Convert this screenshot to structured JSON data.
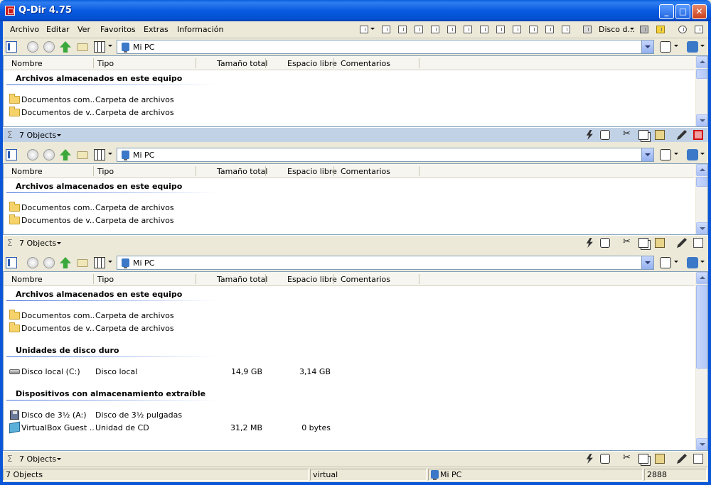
{
  "window": {
    "title": "Q-Dir 4.75"
  },
  "menu": {
    "items": [
      "Archivo",
      "Editar",
      "Ver",
      "Favoritos",
      "Extras",
      "Información"
    ],
    "disk_label": "Disco d..."
  },
  "panes": [
    {
      "address": "Mi PC",
      "columns": [
        "Nombre",
        "Tipo",
        "Tamaño total",
        "Espacio libre",
        "Comentarios"
      ],
      "groups": [
        {
          "title": "Archivos almacenados en este equipo",
          "rows": [
            {
              "name": "Documentos com...",
              "type": "Carpeta de archivos",
              "size": "",
              "free": "",
              "icon": "folder-icon"
            },
            {
              "name": "Documentos de v...",
              "type": "Carpeta de archivos",
              "size": "",
              "free": "",
              "icon": "folder-icon"
            }
          ]
        }
      ],
      "status": "7 Objects"
    },
    {
      "address": "Mi PC",
      "columns": [
        "Nombre",
        "Tipo",
        "Tamaño total",
        "Espacio libre",
        "Comentarios"
      ],
      "groups": [
        {
          "title": "Archivos almacenados en este equipo",
          "rows": [
            {
              "name": "Documentos com...",
              "type": "Carpeta de archivos",
              "size": "",
              "free": "",
              "icon": "folder-icon"
            },
            {
              "name": "Documentos de v...",
              "type": "Carpeta de archivos",
              "size": "",
              "free": "",
              "icon": "folder-icon"
            }
          ]
        }
      ],
      "status": "7 Objects"
    },
    {
      "address": "Mi PC",
      "columns": [
        "Nombre",
        "Tipo",
        "Tamaño total",
        "Espacio libre",
        "Comentarios"
      ],
      "groups": [
        {
          "title": "Archivos almacenados en este equipo",
          "rows": [
            {
              "name": "Documentos com...",
              "type": "Carpeta de archivos",
              "size": "",
              "free": "",
              "icon": "folder-icon"
            },
            {
              "name": "Documentos de v...",
              "type": "Carpeta de archivos",
              "size": "",
              "free": "",
              "icon": "folder-icon"
            }
          ]
        },
        {
          "title": "Unidades de disco duro",
          "rows": [
            {
              "name": "Disco local (C:)",
              "type": "Disco local",
              "size": "14,9 GB",
              "free": "3,14 GB",
              "icon": "hard-disk-icon"
            }
          ]
        },
        {
          "title": "Dispositivos con almacenamiento extraíble",
          "rows": [
            {
              "name": "Disco de 3½ (A:)",
              "type": "Disco de 3½ pulgadas",
              "size": "",
              "free": "",
              "icon": "floppy-icon"
            },
            {
              "name": "VirtualBox Guest ...",
              "type": "Unidad de CD",
              "size": "31,2 MB",
              "free": "0 bytes",
              "icon": "cd-drive-icon"
            }
          ]
        }
      ],
      "status": "7 Objects"
    }
  ],
  "statusbar": {
    "objects": "7 Objects",
    "label": "virtual",
    "location": "Mi PC",
    "number": "2888"
  }
}
